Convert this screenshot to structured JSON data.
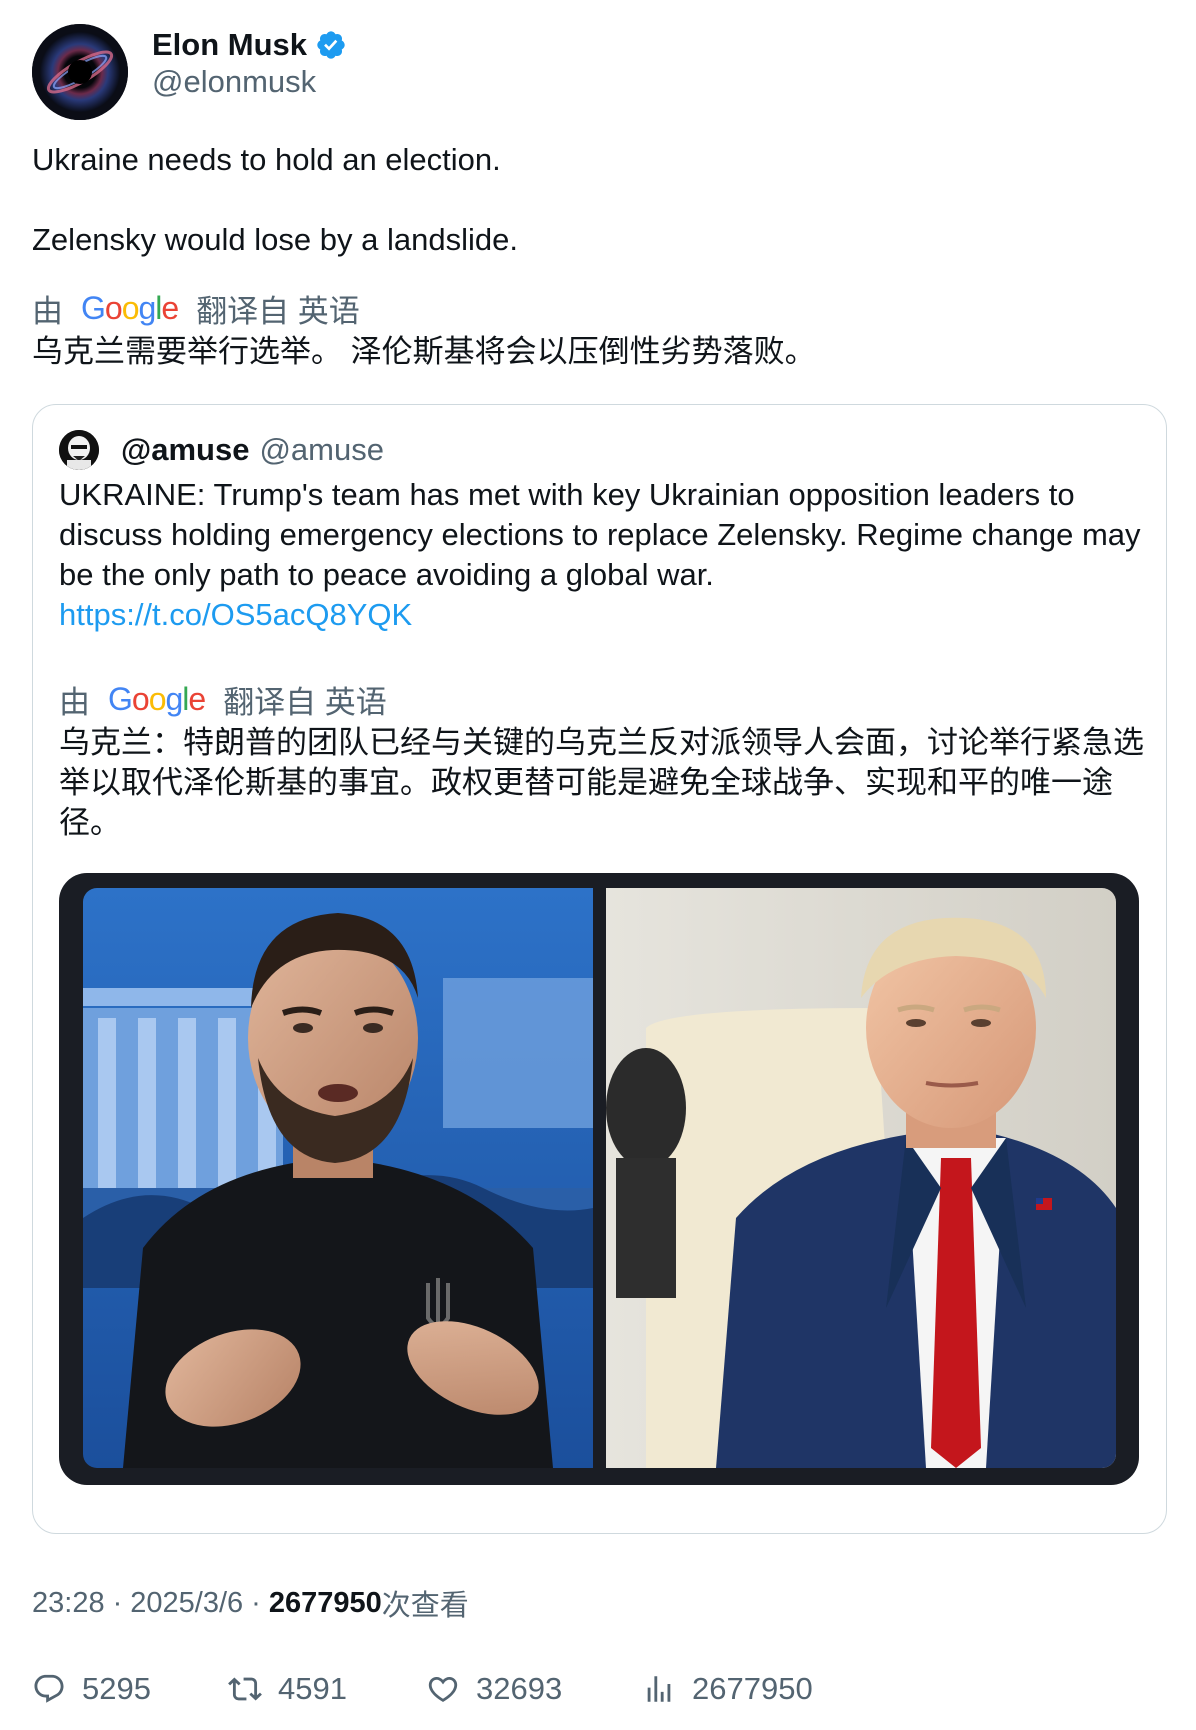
{
  "author": {
    "display_name": "Elon Musk",
    "handle": "@elonmusk",
    "verified": true
  },
  "tweet": {
    "line1": "Ukraine needs to hold an election.",
    "line2": "Zelensky would lose by a landslide.",
    "translate_prefix": "由",
    "translate_suffix": "翻译自 英语",
    "translated_text": "乌克兰需要举行选举。 泽伦斯基将会以压倒性劣势落败。"
  },
  "quote": {
    "display_name": "@amuse",
    "handle": "@amuse",
    "text": "UKRAINE: Trump's team has met with key Ukrainian opposition leaders to discuss holding emergency elections to replace Zelensky. Regime change may be the only path to peace avoiding a global war.",
    "link": "https://t.co/OS5acQ8YQK",
    "translate_prefix": "由",
    "translate_suffix": "翻译自 英语",
    "translated_text": "乌克兰：特朗普的团队已经与关键的乌克兰反对派领导人会面，讨论举行紧急选举以取代泽伦斯基的事宜。政权更替可能是避免全球战争、实现和平的唯一途径。"
  },
  "meta": {
    "time": "23:28",
    "date": "2025/3/6",
    "separator": "·",
    "views_count": "2677950",
    "views_label": "次查看"
  },
  "actions": {
    "replies": "5295",
    "retweets": "4591",
    "likes": "32693",
    "views": "2677950"
  },
  "colors": {
    "link": "#1d9bf0",
    "secondary_text": "#536471",
    "verified": "#1d9bf0",
    "tie_red": "#c4161c",
    "suit_navy": "#1f3566"
  },
  "icons": [
    "verified-badge-icon",
    "google-logo",
    "reply-icon",
    "retweet-icon",
    "like-icon",
    "views-icon"
  ]
}
